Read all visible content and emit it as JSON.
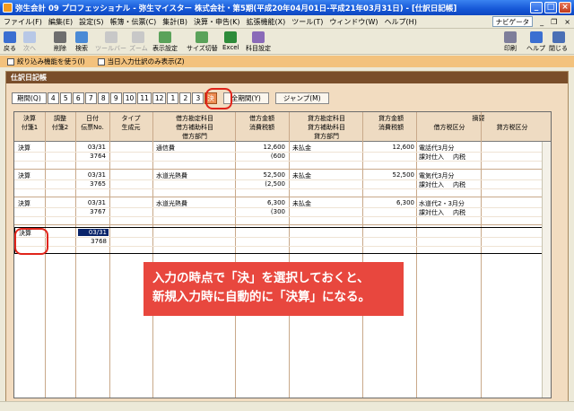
{
  "window": {
    "title": "弥生会計 09 プロフェッショナル - 弥生マイスター 株式会社・第5期(平成20年04月01日-平成21年03月31日) - [仕訳日記帳]"
  },
  "menu": [
    "ファイル(F)",
    "編集(E)",
    "設定(S)",
    "帳簿・伝票(C)",
    "集計(B)",
    "決算・申告(K)",
    "拡張機能(X)",
    "ツール(T)",
    "ウィンドウ(W)",
    "ヘルプ(H)"
  ],
  "navi_label": "ナビゲータ",
  "toolbar": {
    "back": "戻る",
    "next": "次へ",
    "delete": "削除",
    "search": "検索",
    "copy": "ツールバー",
    "zoom": "ズーム",
    "display": "表示設定",
    "size": "サイズ切替",
    "excel": "Excel",
    "account": "科目設定",
    "print": "印刷",
    "help": "ヘルプ",
    "close": "閉じる"
  },
  "options": {
    "filter": "絞り込み機能を使う(I)",
    "today": "当日入力仕訳のみ表示(Z)"
  },
  "panel_title": "仕訳日記帳",
  "periods": [
    "期間(Q)",
    "4",
    "5",
    "6",
    "7",
    "8",
    "9",
    "10",
    "11",
    "12",
    "1",
    "2",
    "3",
    "決"
  ],
  "buttons": {
    "all": "全期間(Y)",
    "jump": "ジャンプ(M)"
  },
  "headers": {
    "kessan": "決算",
    "chosei": "調整",
    "date": "日付",
    "type": "タイプ",
    "debit_acct": "借方勘定科目",
    "debit_amt": "借方金額",
    "credit_acct": "貸方勘定科目",
    "credit_amt": "貸方金額",
    "memo": "摘要",
    "fusen1": "付箋1",
    "fusen2": "付箋2",
    "slip": "伝票No.",
    "origin": "生成元",
    "debit_sub": "借方補助科目",
    "debit_tax": "消費税額",
    "credit_sub": "貸方補助科目",
    "credit_tax": "消費税額",
    "debit_taxclass": "借方税区分",
    "credit_taxclass": "貸方税区分",
    "debit_dept": "借方部門",
    "credit_dept": "貸方部門"
  },
  "entries": [
    {
      "kessan": "決算",
      "date": "03/31",
      "slip": "3764",
      "debit": "通信費",
      "debit_amt": "12,600",
      "debit_tax": "(600",
      "credit": "未払金",
      "credit_amt": "12,600",
      "memo": "電話代3月分",
      "taxclass": "課対仕入",
      "taxtype": "内税"
    },
    {
      "kessan": "決算",
      "date": "03/31",
      "slip": "3765",
      "debit": "水道光熱費",
      "debit_amt": "52,500",
      "debit_tax": "(2,500",
      "credit": "未払金",
      "credit_amt": "52,500",
      "memo": "電気代3月分",
      "taxclass": "課対仕入",
      "taxtype": "内税"
    },
    {
      "kessan": "決算",
      "date": "03/31",
      "slip": "3767",
      "debit": "水道光熱費",
      "debit_amt": "6,300",
      "debit_tax": "(300",
      "credit": "未払金",
      "credit_amt": "6,300",
      "memo": "水道代2・3月分",
      "taxclass": "課対仕入",
      "taxtype": "内税"
    },
    {
      "kessan": "決算",
      "date": "03/31",
      "slip": "3768"
    }
  ],
  "callout": {
    "line1": "入力の時点で「決」を選択しておくと、",
    "line2": "新規入力時に自動的に「決算」になる。"
  },
  "colors": {
    "title": "#1557d6",
    "option_bar": "#f3c27d",
    "panel": "#f2dcc0",
    "header_bar": "#7a4e2a",
    "active": "#ec8c52",
    "callout": "#e8473e",
    "highlight": "#e0241a"
  }
}
